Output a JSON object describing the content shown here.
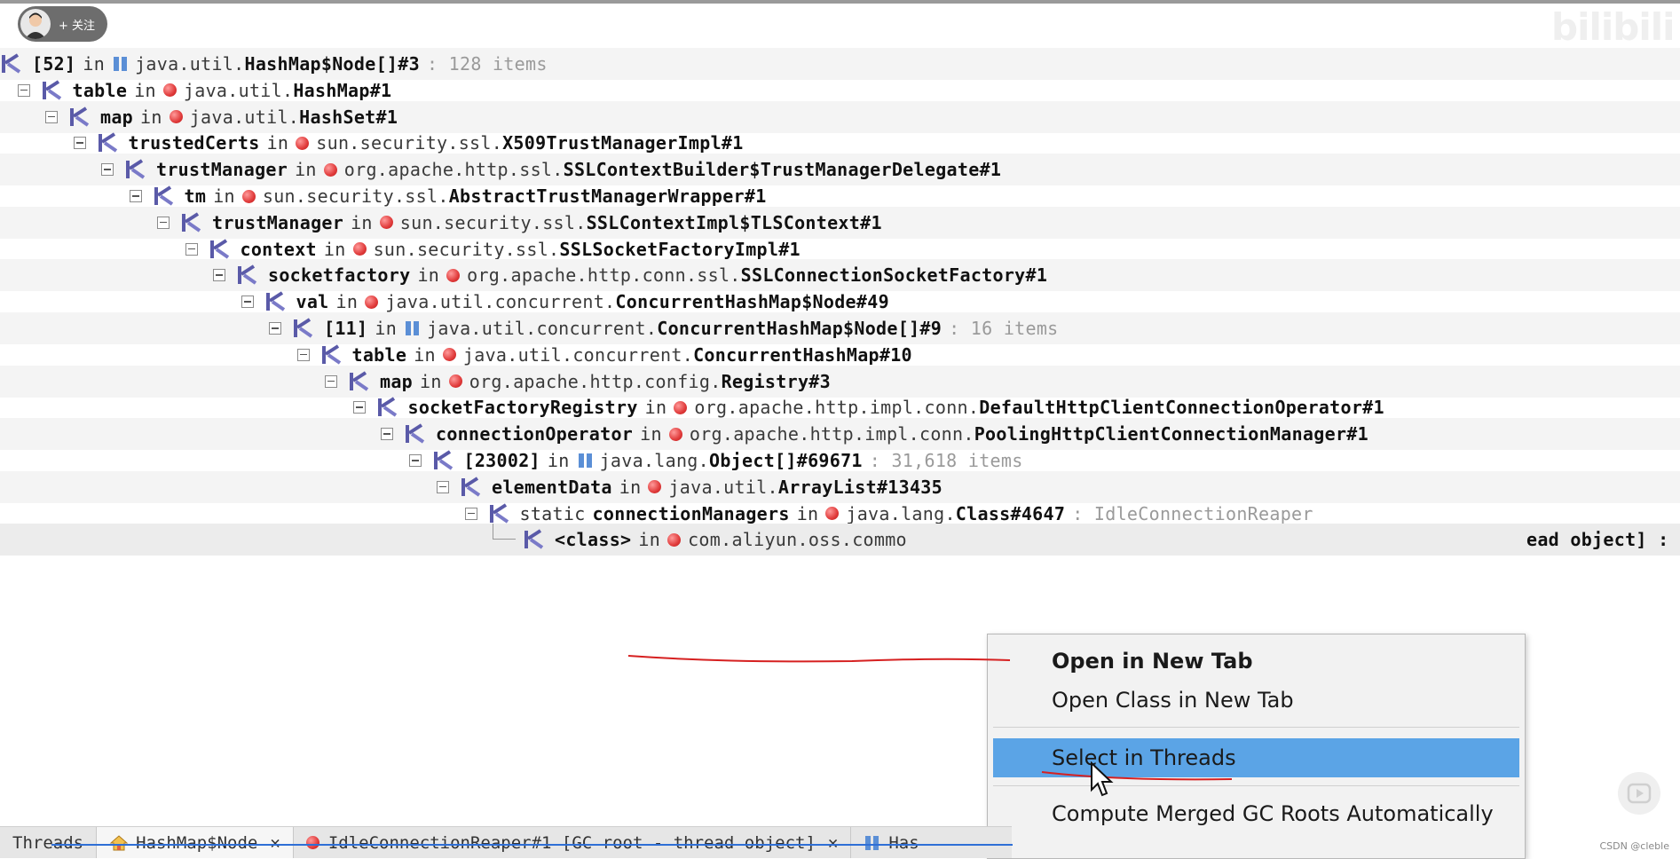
{
  "overlay": {
    "follow_label": "+ 关注",
    "credit": "CSDN @cleble"
  },
  "tree": {
    "rows": [
      {
        "field": "[52]",
        "kind": "array",
        "pkg": "java.util.",
        "cls": "HashMap$Node[]#3",
        "extra": ": 128 items"
      },
      {
        "field": "table",
        "kind": "object",
        "pkg": "java.util.",
        "cls": "HashMap#1"
      },
      {
        "field": "map",
        "kind": "object",
        "pkg": "java.util.",
        "cls": "HashSet#1"
      },
      {
        "field": "trustedCerts",
        "kind": "object",
        "pkg": "sun.security.ssl.",
        "cls": "X509TrustManagerImpl#1"
      },
      {
        "field": "trustManager",
        "kind": "object",
        "pkg": "org.apache.http.ssl.",
        "cls": "SSLContextBuilder$TrustManagerDelegate#1"
      },
      {
        "field": "tm",
        "kind": "object",
        "pkg": "sun.security.ssl.",
        "cls": "AbstractTrustManagerWrapper#1"
      },
      {
        "field": "trustManager",
        "kind": "object",
        "pkg": "sun.security.ssl.",
        "cls": "SSLContextImpl$TLSContext#1"
      },
      {
        "field": "context",
        "kind": "object",
        "pkg": "sun.security.ssl.",
        "cls": "SSLSocketFactoryImpl#1"
      },
      {
        "field": "socketfactory",
        "kind": "object",
        "pkg": "org.apache.http.conn.ssl.",
        "cls": "SSLConnectionSocketFactory#1"
      },
      {
        "field": "val",
        "kind": "object",
        "pkg": "java.util.concurrent.",
        "cls": "ConcurrentHashMap$Node#49"
      },
      {
        "field": "[11]",
        "kind": "array",
        "pkg": "java.util.concurrent.",
        "cls": "ConcurrentHashMap$Node[]#9",
        "extra": ": 16 items"
      },
      {
        "field": "table",
        "kind": "object",
        "pkg": "java.util.concurrent.",
        "cls": "ConcurrentHashMap#10"
      },
      {
        "field": "map",
        "kind": "object",
        "pkg": "org.apache.http.config.",
        "cls": "Registry#3"
      },
      {
        "field": "socketFactoryRegistry",
        "kind": "object",
        "pkg": "org.apache.http.impl.conn.",
        "cls": "DefaultHttpClientConnectionOperator#1"
      },
      {
        "field": "connectionOperator",
        "kind": "object",
        "pkg": "org.apache.http.impl.conn.",
        "cls": "PoolingHttpClientConnectionManager#1"
      },
      {
        "field": "[23002]",
        "kind": "array",
        "pkg": "java.lang.",
        "cls": "Object[]#69671",
        "extra": ": 31,618 items"
      },
      {
        "field": "elementData",
        "kind": "object",
        "pkg": "java.util.",
        "cls": "ArrayList#13435"
      },
      {
        "field": "connectionManagers",
        "prefix": "static",
        "kind": "object",
        "pkg": "java.lang.",
        "cls": "Class#4647",
        "extra": ": IdleConnectionReaper"
      },
      {
        "field": "<class>",
        "kind": "object",
        "pkg": "com.aliyun.oss.commo",
        "cls": "",
        "tail": "ead object]  :"
      }
    ]
  },
  "context_menu": {
    "items": [
      {
        "label": "Open in New Tab"
      },
      {
        "label": "Open Class in New Tab"
      },
      {
        "label": "Select in Threads"
      },
      {
        "label": "Compute Merged GC Roots Automatically"
      }
    ]
  },
  "tabs": [
    {
      "label": "Threads"
    },
    {
      "label": "HashMap$Node",
      "close": "✕"
    },
    {
      "label": "IdleConnectionReaper#1 [GC root - thread object]",
      "close": "✕"
    },
    {
      "label": "Has"
    }
  ]
}
